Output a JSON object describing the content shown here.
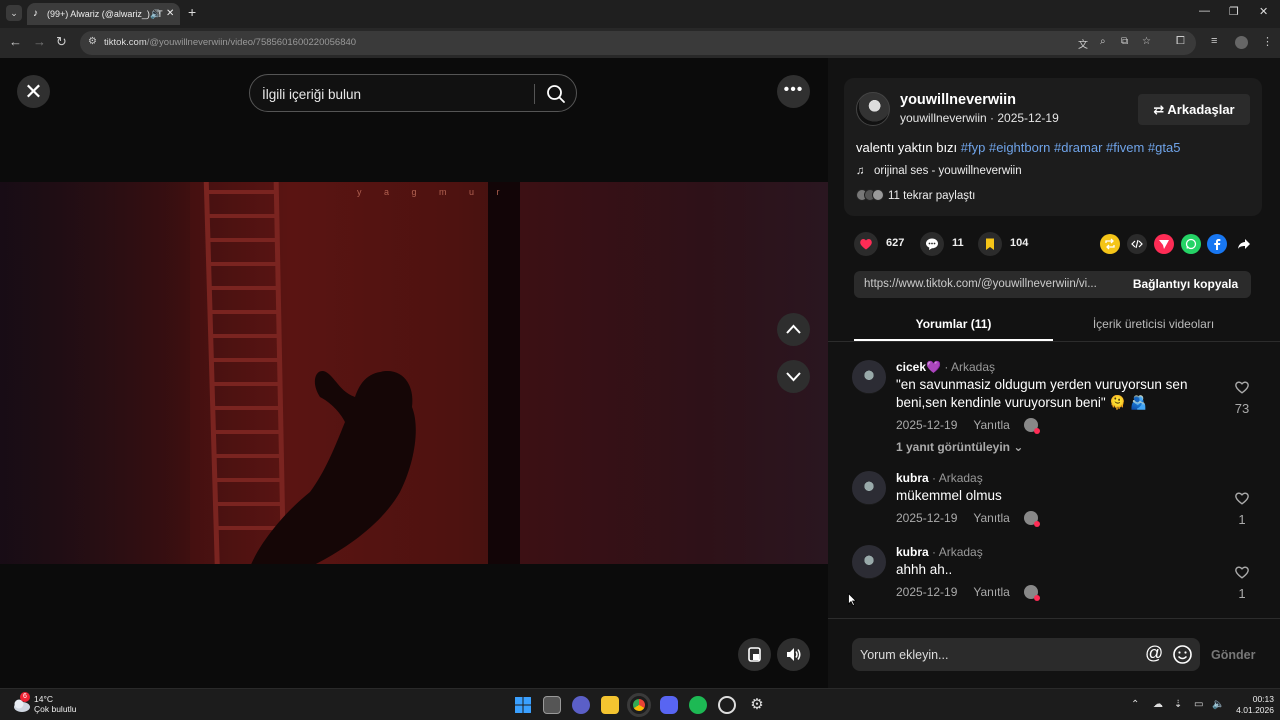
{
  "browser": {
    "tab_title": "(99+) Alwariz (@alwariz_) | T",
    "url_host": "tiktok.com",
    "url_path": "/@youwillneverwiin/video/7585601600220056840"
  },
  "video": {
    "search_placeholder": "İlgili içeriği bulun",
    "watermark": "y a g m u r"
  },
  "author": {
    "display_name": "youwillneverwiin",
    "username_date": "youwillneverwiin · 2025-12-19",
    "friends_label": "Arkadaşlar",
    "caption_text": "valentı yaktın bızı ",
    "hashtags": "#fyp #eightborn #dramar #fivem #gta5",
    "music": "orijinal ses - youwillneverwiin",
    "reposts": "11 tekrar paylaştı"
  },
  "stats": {
    "likes": "627",
    "comments": "11",
    "saves": "104"
  },
  "share_colors": [
    "#f5c518",
    "#2b2b2b",
    "#fe2c55",
    "#25d366",
    "#1877f2"
  ],
  "link": {
    "url": "https://www.tiktok.com/@youwillneverwiin/vi...",
    "copy_label": "Bağlantıyı kopyala"
  },
  "tabs": {
    "comments": "Yorumlar (11)",
    "creator_videos": "İçerik üreticisi videoları"
  },
  "comments": [
    {
      "user": "cicek💜",
      "tag": "· Arkadaş",
      "text": "\"en savunmasiz oldugum yerden vuruyorsun sen beni,sen kendinle vuruyorsun beni\" 🫠 🫂",
      "date": "2025-12-19",
      "reply": "Yanıtla",
      "likes": "73",
      "more_replies": "1 yanıt görüntüleyin ⌄"
    },
    {
      "user": "kubra",
      "tag": "· Arkadaş",
      "text": "mükemmel olmus",
      "date": "2025-12-19",
      "reply": "Yanıtla",
      "likes": "1"
    },
    {
      "user": "kubra",
      "tag": "· Arkadaş",
      "text": "ahhh ah..",
      "date": "2025-12-19",
      "reply": "Yanıtla",
      "likes": "1"
    }
  ],
  "comment_box": {
    "placeholder": "Yorum ekleyin...",
    "send_label": "Gönder"
  },
  "taskbar": {
    "temp": "14°C",
    "weather": "Çok bulutlu",
    "time": "00:13",
    "date": "4.01.2026",
    "weather_badge": "6"
  }
}
